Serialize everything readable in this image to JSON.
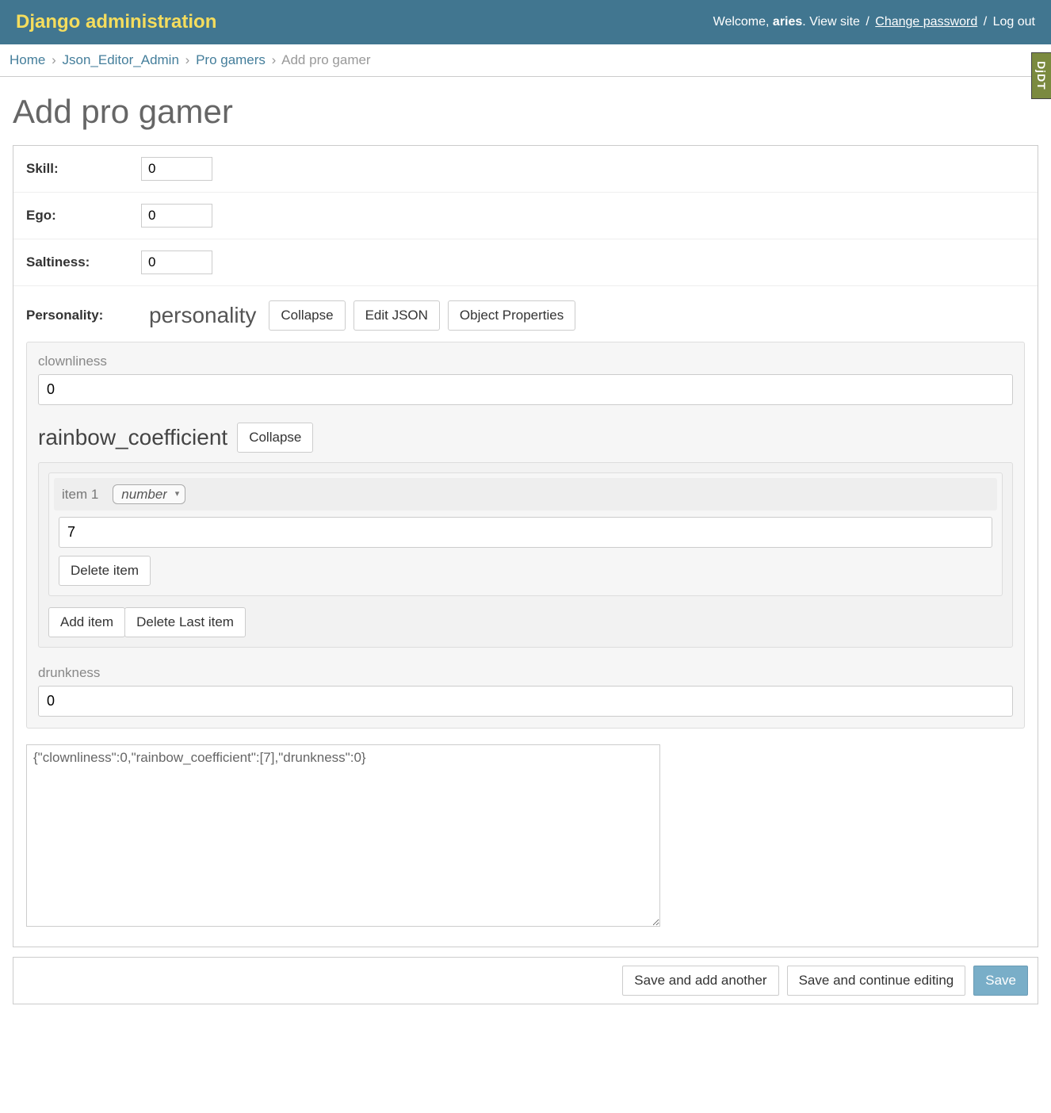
{
  "header": {
    "site_title": "Django administration",
    "welcome_prefix": "Welcome, ",
    "username": "aries",
    "view_site": "View site",
    "change_password": "Change password",
    "logout": "Log out"
  },
  "breadcrumbs": {
    "home": "Home",
    "app": "Json_Editor_Admin",
    "model": "Pro gamers",
    "current": "Add pro gamer"
  },
  "djdt": "DjDT",
  "page_title": "Add pro gamer",
  "fields": {
    "skill": {
      "label": "Skill:",
      "value": "0"
    },
    "ego": {
      "label": "Ego:",
      "value": "0"
    },
    "saltiness": {
      "label": "Saltiness:",
      "value": "0"
    }
  },
  "personality": {
    "label": "Personality:",
    "editor_title": "personality",
    "buttons": {
      "collapse": "Collapse",
      "edit_json": "Edit JSON",
      "object_properties": "Object Properties"
    },
    "clownliness": {
      "label": "clownliness",
      "value": "0"
    },
    "rainbow": {
      "title": "rainbow_coefficient",
      "collapse": "Collapse",
      "item_label": "item 1",
      "type_options": [
        "number"
      ],
      "type_selected": "number",
      "item_value": "7",
      "delete_item": "Delete item",
      "add_item": "Add item",
      "delete_last": "Delete Last item"
    },
    "drunkness": {
      "label": "drunkness",
      "value": "0"
    },
    "raw_json": "{\"clownliness\":0,\"rainbow_coefficient\":[7],\"drunkness\":0}"
  },
  "submit": {
    "add_another": "Save and add another",
    "continue": "Save and continue editing",
    "save": "Save"
  }
}
